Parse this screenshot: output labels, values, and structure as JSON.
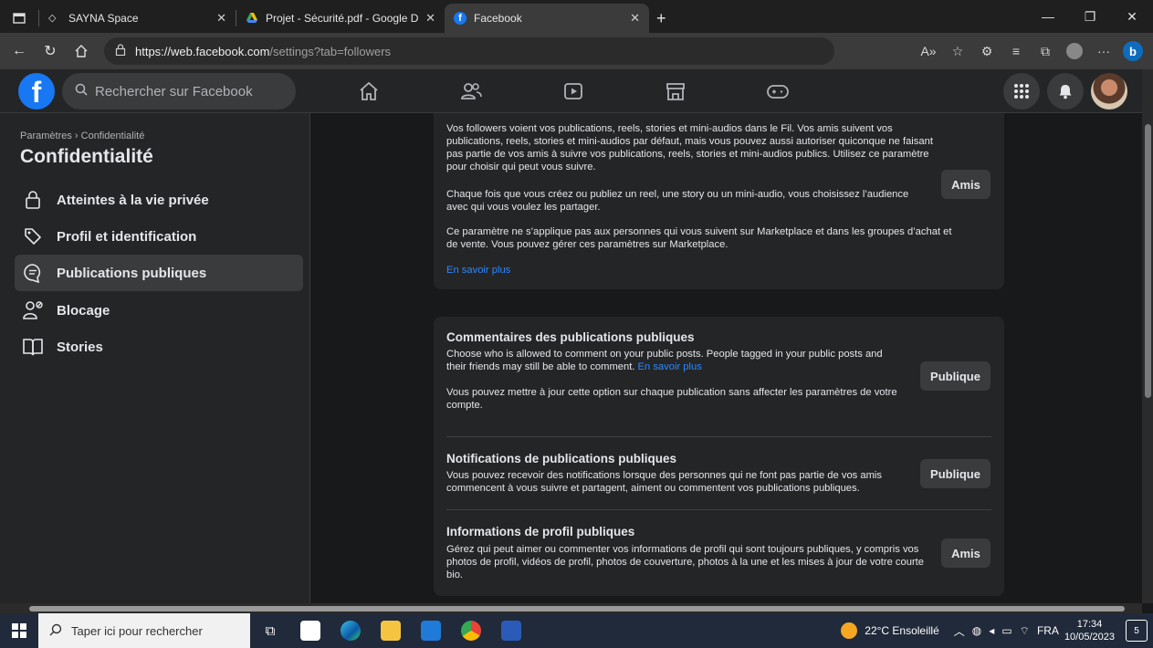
{
  "browser": {
    "tabs": [
      {
        "title": "SAYNA Space",
        "active": false
      },
      {
        "title": "Projet - Sécurité.pdf - Google Dri",
        "active": false
      },
      {
        "title": "Facebook",
        "active": true
      }
    ],
    "new_tab": "+",
    "url_host": "https://web.facebook.com",
    "url_path": "/settings?tab=followers"
  },
  "fb": {
    "logo": "f",
    "search_placeholder": "Rechercher sur Facebook",
    "nav_icons": [
      "home-icon",
      "friends-icon",
      "watch-icon",
      "marketplace-icon",
      "gaming-icon"
    ]
  },
  "sidebar": {
    "breadcrumb": "Paramètres › Confidentialité",
    "title": "Confidentialité",
    "items": [
      {
        "label": "Atteintes à la vie privée",
        "icon": "lock-icon"
      },
      {
        "label": "Profil et identification",
        "icon": "tag-icon"
      },
      {
        "label": "Publications publiques",
        "icon": "comment-icon",
        "active": true
      },
      {
        "label": "Blocage",
        "icon": "block-user-icon"
      },
      {
        "label": "Stories",
        "icon": "book-icon"
      }
    ]
  },
  "followers": {
    "p1": "Vos followers voient vos publications, reels, stories et mini-audios dans le Fil. Vos amis suivent vos publications, reels, stories et mini-audios par défaut, mais vous pouvez aussi autoriser quiconque ne faisant pas partie de vos amis à suivre vos publications, reels, stories et mini-audios publics. Utilisez ce paramètre pour choisir qui peut vous suivre.",
    "p2": "Chaque fois que vous créez ou publiez un reel, une story ou un mini-audio, vous choisissez l’audience avec qui vous voulez les partager.",
    "p3": "Ce paramètre ne s’applique pas aux personnes qui vous suivent sur Marketplace et dans les groupes d’achat et de vente. Vous pouvez gérer ces paramètres sur Marketplace.",
    "learn_more": "En savoir plus",
    "button": "Amis"
  },
  "comments": {
    "title": "Commentaires des publications publiques",
    "desc": "Choose who is allowed to comment on your public posts. People tagged in your public posts and their friends may still be able to comment.",
    "learn_more": "En savoir plus",
    "note": "Vous pouvez mettre à jour cette option sur chaque publication sans affecter les paramètres de votre compte.",
    "button": "Publique"
  },
  "notifications": {
    "title": "Notifications de publications publiques",
    "desc": "Vous pouvez recevoir des notifications lorsque des personnes qui ne font pas partie de vos amis commencent à vous suivre et partagent, aiment ou commentent vos publications publiques.",
    "button": "Publique"
  },
  "profile_info": {
    "title": "Informations de profil publiques",
    "desc": "Gérez qui peut aimer ou commenter vos informations de profil qui sont toujours publiques, y compris vos photos de profil, vidéos de profil, photos de couverture, photos à la une et les mises à jour de votre courte bio.",
    "button": "Amis"
  },
  "taskbar": {
    "search_placeholder": "Taper ici pour rechercher",
    "weather": "22°C  Ensoleillé",
    "lang": "FRA",
    "time": "17:34",
    "date": "10/05/2023",
    "notif_count": "5"
  },
  "colors": {
    "fb_blue": "#1877f2",
    "link": "#2d88ff",
    "card_bg": "#242526",
    "page_bg": "#18191a"
  }
}
